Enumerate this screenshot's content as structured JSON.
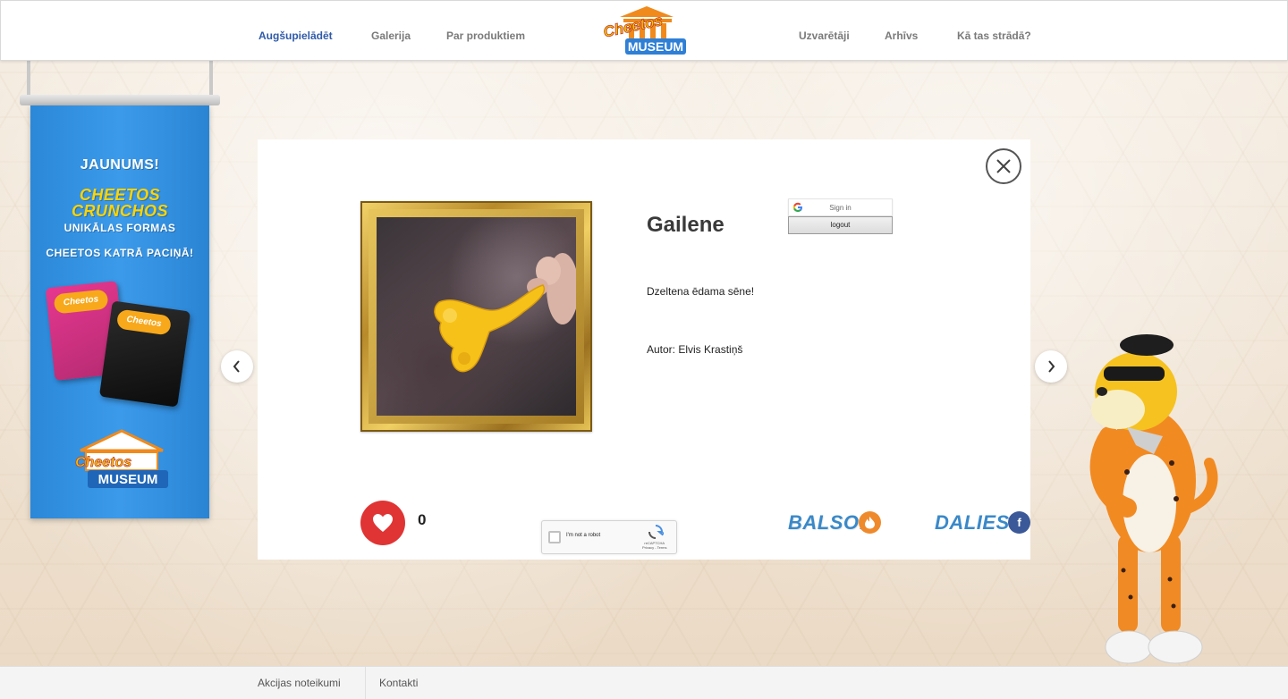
{
  "header": {
    "nav_left": [
      "Augšupielādēt",
      "Galerija",
      "Par produktiem"
    ],
    "nav_right": [
      "Uzvarētāji",
      "Arhīvs",
      "Kā tas strādā?"
    ],
    "logo_text_top": "Cheetos",
    "logo_text_bottom": "MUSEUM"
  },
  "banner": {
    "line1": "JAUNUMS!",
    "line2": "CHEETOS",
    "line3": "CRUNCHOS",
    "line4": "UNIKĀLAS FORMAS",
    "line5": "CHEETOS KATRĀ PACIŅĀ!",
    "bag_logo": "Cheetos",
    "museum_top": "Cheetos",
    "museum_bottom": "MUSEUM"
  },
  "entry": {
    "title": "Gailene",
    "description": "Dzeltena ēdama sēne!",
    "author": "Autor: Elvis Krastiņš",
    "likes": "0"
  },
  "auth": {
    "google_signin": "Sign in",
    "logout": "logout"
  },
  "recaptcha": {
    "label": "I'm not a robot",
    "brand": "reCAPTCHA",
    "links": "Privacy - Terms"
  },
  "actions": {
    "vote": "BALSO!",
    "share": "DALIES!",
    "share_icon": "f"
  },
  "footer": {
    "links": [
      "Akcijas noteikumi",
      "Kontakti"
    ]
  },
  "colors": {
    "active_nav": "#2f5aa8",
    "like": "#e03434",
    "vote_blue": "#3a89c9",
    "fire": "#ef8a2c",
    "facebook": "#3b5998"
  }
}
